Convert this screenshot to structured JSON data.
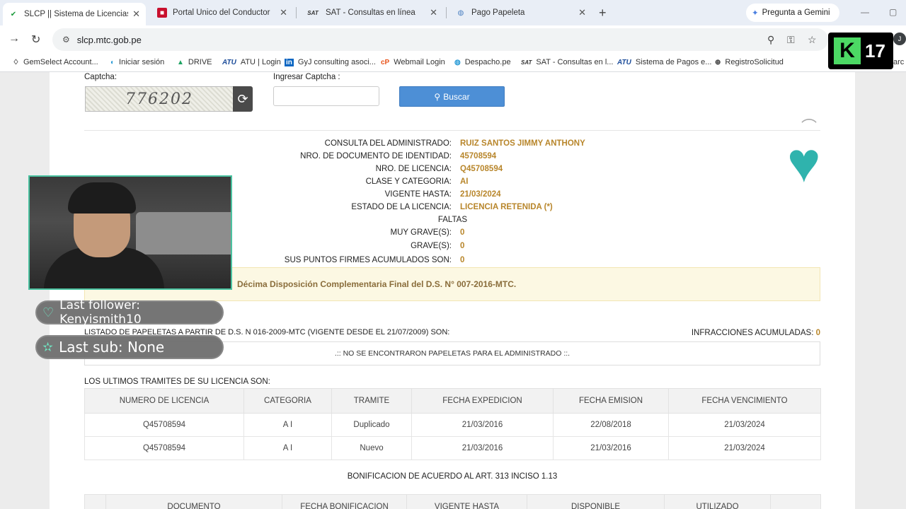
{
  "browser": {
    "tabs": [
      {
        "label": "SLCP || Sistema de Licencias de",
        "icon": "shield-icon",
        "active": true
      },
      {
        "label": "Portal Único del Conductor",
        "icon": "peru-icon",
        "active": false
      },
      {
        "label": "SAT - Consultas en línea",
        "icon": "sat-icon",
        "active": false
      },
      {
        "label": "Pago Papeleta",
        "icon": "globe-icon",
        "active": false
      }
    ],
    "gemini_label": "Pregunta a Gemini",
    "url": "slcp.mtc.gob.pe",
    "bookmarks": [
      "GemSelect Account...",
      "Iniciar sesión",
      "DRIVE",
      "ATU | Login",
      "GyJ consulting asoci...",
      "Webmail Login",
      "Despacho.pe",
      "SAT - Consultas en l...",
      "Sistema de Pagos e...",
      "RegistroSolicitud",
      "arc"
    ],
    "bookmark_icons": {
      "sat": "SAT",
      "atu": "ATU",
      "linkedin": "in"
    }
  },
  "form": {
    "captcha_label": "Captcha:",
    "captcha_value": "776202",
    "input_label": "Ingresar Captcha :",
    "search_button": "Buscar"
  },
  "info": {
    "rows": [
      {
        "key": "CONSULTA DEL ADMINISTRADO:",
        "value": "RUIZ SANTOS JIMMY ANTHONY"
      },
      {
        "key": "NRO. DE DOCUMENTO DE IDENTIDAD:",
        "value": "45708594"
      },
      {
        "key": "NRO. DE LICENCIA:",
        "value": "Q45708594"
      },
      {
        "key": "CLASE Y CATEGORIA:",
        "value": "AI"
      },
      {
        "key": "VIGENTE HASTA:",
        "value": "21/03/2024"
      },
      {
        "key": "ESTADO DE LA LICENCIA:",
        "value": "LICENCIA RETENIDA (*)"
      }
    ],
    "faltas_label": "FALTAS",
    "faltas": [
      {
        "key": "MUY GRAVE(S):",
        "value": "0"
      },
      {
        "key": "GRAVE(S):",
        "value": "0"
      },
      {
        "key": "SUS PUNTOS FIRMES ACUMULADOS SON:",
        "value": "0"
      }
    ]
  },
  "notice": "Décima Disposición Complementaria Final del D.S. N° 007-2016-MTC.",
  "papeletas": {
    "title": "LISTADO DE PAPELETAS A PARTIR DE D.S. N 016-2009-MTC (VIGENTE DESDE EL 21/07/2009) SON:",
    "infracciones_label": "INFRACCIONES ACUMULADAS:",
    "infracciones_value": "0",
    "empty_message": ".:: NO SE ENCONTRARON PAPELETAS PARA EL ADMINISTRADO ::."
  },
  "tramites": {
    "title": "LOS ULTIMOS TRAMITES DE SU LICENCIA SON:",
    "headers": [
      "NUMERO DE LICENCIA",
      "CATEGORIA",
      "TRAMITE",
      "FECHA EXPEDICION",
      "FECHA EMISION",
      "FECHA VENCIMIENTO"
    ],
    "rows": [
      [
        "Q45708594",
        "A I",
        "Duplicado",
        "21/03/2016",
        "22/08/2018",
        "21/03/2024"
      ],
      [
        "Q45708594",
        "A I",
        "Nuevo",
        "21/03/2016",
        "21/03/2016",
        "21/03/2024"
      ]
    ]
  },
  "bonificacion": {
    "title": "BONIFICACION DE ACUERDO AL ART. 313 INCISO 1.13",
    "headers": [
      "",
      "DOCUMENTO",
      "FECHA BONIFICACION",
      "VIGENTE HASTA",
      "DISPONIBLE",
      "UTILIZADO",
      ""
    ]
  },
  "overlay": {
    "last_follower": "Last follower: Kenyismith10",
    "last_sub": "Last sub: None",
    "k_badge_letter": "K",
    "k_badge_number": "17",
    "colors": {
      "accent": "#4ac2a0",
      "heart": "#2fb3ad",
      "value": "#b8862b",
      "button": "#4d8fd6"
    }
  }
}
